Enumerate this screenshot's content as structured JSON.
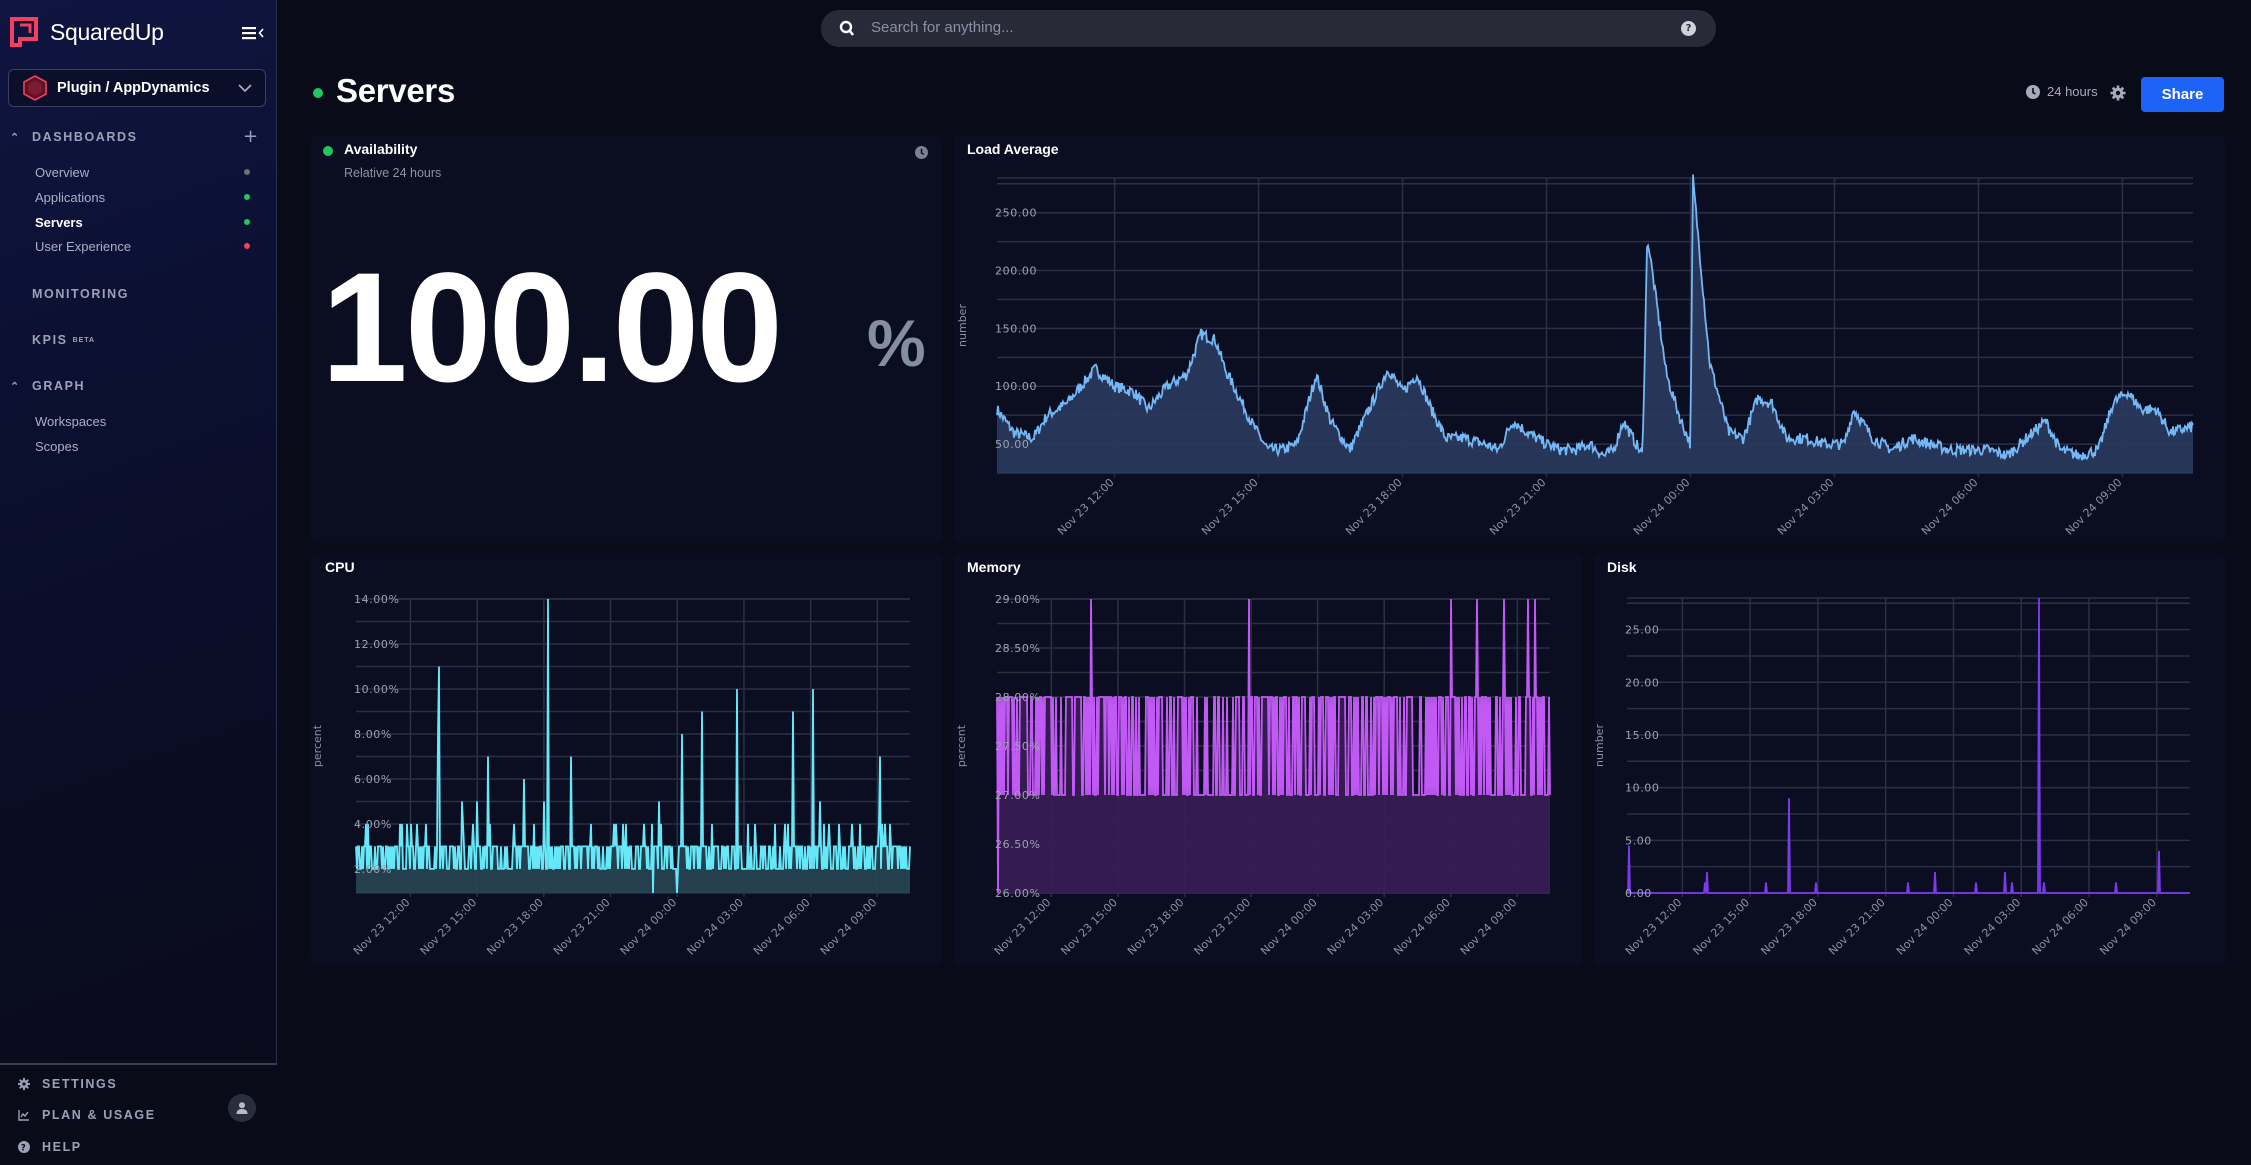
{
  "app": {
    "brand": "SquaredUp",
    "workspace": "Plugin / AppDynamics"
  },
  "sidebar": {
    "sections": [
      {
        "label": "DASHBOARDS",
        "collapsible": true
      },
      {
        "label": "MONITORING",
        "collapsible": false
      },
      {
        "label": "KPIS",
        "badge": "BETA",
        "collapsible": false
      },
      {
        "label": "GRAPH",
        "collapsible": true
      }
    ],
    "dashboards": [
      {
        "label": "Overview",
        "status": "unknown",
        "color": "#6b6f7e"
      },
      {
        "label": "Applications",
        "status": "success",
        "color": "#22c55e"
      },
      {
        "label": "Servers",
        "status": "success",
        "color": "#22c55e",
        "active": true
      },
      {
        "label": "User Experience",
        "status": "error",
        "color": "#f43f5e"
      }
    ],
    "graph_items": [
      {
        "label": "Workspaces"
      },
      {
        "label": "Scopes"
      }
    ],
    "footer": [
      {
        "label": "SETTINGS",
        "icon": "gear-icon"
      },
      {
        "label": "PLAN & USAGE",
        "icon": "chart-line-icon"
      },
      {
        "label": "HELP",
        "icon": "help-circle-icon"
      }
    ]
  },
  "search": {
    "placeholder": "Search for anything..."
  },
  "header": {
    "title": "Servers",
    "status_color": "#22c55e",
    "timeframe": "24 hours",
    "share_label": "Share",
    "share_color": "#1d63f5"
  },
  "tiles": {
    "availability": {
      "title": "Availability",
      "subtitle": "Relative 24 hours",
      "value": "100.00",
      "unit": "%",
      "status_color": "#22c55e"
    }
  },
  "chart_data": [
    {
      "id": "load",
      "title": "Load Average",
      "type": "area",
      "ylabel": "number",
      "color": "#74b7f5",
      "fill": "#2a3a5e",
      "ylim": [
        25,
        280
      ],
      "ygrid_step": 25,
      "yticks": [
        50,
        100,
        150,
        200,
        250
      ],
      "ytick_labels": [
        "50.00",
        "100.00",
        "150.00",
        "200.00",
        "250.00"
      ],
      "xrange_hours": [
        9.55,
        34.47
      ],
      "xticks_hours": [
        12,
        15,
        18,
        21,
        24,
        27,
        30,
        33
      ],
      "xtick_labels": [
        "Nov 23 12:00",
        "Nov 23 15:00",
        "Nov 23 18:00",
        "Nov 23 21:00",
        "Nov 24 00:00",
        "Nov 24 03:00",
        "Nov 24 06:00",
        "Nov 24 09:00"
      ],
      "keypoints": [
        [
          9.55,
          80
        ],
        [
          9.9,
          60
        ],
        [
          10.3,
          55
        ],
        [
          10.6,
          75
        ],
        [
          11.0,
          85
        ],
        [
          11.3,
          100
        ],
        [
          11.6,
          115
        ],
        [
          12.0,
          100
        ],
        [
          12.4,
          95
        ],
        [
          12.7,
          80
        ],
        [
          13.1,
          100
        ],
        [
          13.5,
          110
        ],
        [
          13.8,
          145
        ],
        [
          14.1,
          140
        ],
        [
          14.3,
          115
        ],
        [
          14.6,
          90
        ],
        [
          14.9,
          65
        ],
        [
          15.2,
          45
        ],
        [
          15.5,
          45
        ],
        [
          15.8,
          50
        ],
        [
          16.0,
          80
        ],
        [
          16.2,
          110
        ],
        [
          16.5,
          70
        ],
        [
          16.9,
          45
        ],
        [
          17.3,
          80
        ],
        [
          17.7,
          115
        ],
        [
          18.0,
          95
        ],
        [
          18.3,
          110
        ],
        [
          18.6,
          80
        ],
        [
          18.9,
          55
        ],
        [
          19.3,
          55
        ],
        [
          19.7,
          50
        ],
        [
          20.0,
          45
        ],
        [
          20.3,
          70
        ],
        [
          20.6,
          60
        ],
        [
          21.0,
          50
        ],
        [
          21.3,
          45
        ],
        [
          21.6,
          45
        ],
        [
          21.9,
          50
        ],
        [
          22.2,
          40
        ],
        [
          22.4,
          45
        ],
        [
          22.6,
          70
        ],
        [
          22.8,
          55
        ],
        [
          23.0,
          40
        ],
        [
          23.1,
          230
        ],
        [
          23.5,
          110
        ],
        [
          23.8,
          70
        ],
        [
          24.0,
          50
        ],
        [
          24.05,
          280
        ],
        [
          24.4,
          120
        ],
        [
          24.8,
          60
        ],
        [
          25.1,
          55
        ],
        [
          25.4,
          90
        ],
        [
          25.7,
          85
        ],
        [
          26.0,
          55
        ],
        [
          26.4,
          55
        ],
        [
          26.8,
          50
        ],
        [
          27.2,
          50
        ],
        [
          27.4,
          80
        ],
        [
          27.8,
          55
        ],
        [
          28.2,
          45
        ],
        [
          28.6,
          55
        ],
        [
          29.0,
          50
        ],
        [
          29.4,
          45
        ],
        [
          29.8,
          45
        ],
        [
          30.2,
          45
        ],
        [
          30.6,
          40
        ],
        [
          31.0,
          55
        ],
        [
          31.4,
          70
        ],
        [
          31.7,
          45
        ],
        [
          32.1,
          40
        ],
        [
          32.5,
          45
        ],
        [
          32.8,
          85
        ],
        [
          33.1,
          95
        ],
        [
          33.4,
          80
        ],
        [
          33.7,
          80
        ],
        [
          34.0,
          60
        ],
        [
          34.47,
          65
        ]
      ],
      "noise": 5
    },
    {
      "id": "cpu",
      "title": "CPU",
      "type": "area",
      "ylabel": "percent",
      "color": "#67e8f9",
      "fill": "#274654",
      "ylim": [
        0.93,
        14
      ],
      "ygrid_step": 1,
      "yticks": [
        2,
        4,
        6,
        8,
        10,
        12,
        14
      ],
      "ytick_labels": [
        "2.00%",
        "4.00%",
        "6.00%",
        "8.00%",
        "10.00%",
        "12.00%",
        "14.00%"
      ],
      "xrange_hours": [
        9.55,
        34.47
      ],
      "xticks_hours": [
        12,
        15,
        18,
        21,
        24,
        27,
        30,
        33
      ],
      "xtick_labels": [
        "Nov 23 12:00",
        "Nov 23 15:00",
        "Nov 23 18:00",
        "Nov 23 21:00",
        "Nov 24 00:00",
        "Nov 24 03:00",
        "Nov 24 06:00",
        "Nov 24 09:00"
      ],
      "baseline": [
        2,
        3
      ],
      "small_spike_value": 4,
      "spikes": [
        [
          13.3,
          11
        ],
        [
          13.25,
          8
        ],
        [
          15.5,
          7
        ],
        [
          17.1,
          6
        ],
        [
          18.2,
          14
        ],
        [
          19.2,
          7
        ],
        [
          14.3,
          5
        ],
        [
          15.0,
          5
        ],
        [
          18.0,
          5
        ],
        [
          23.2,
          5
        ],
        [
          24.2,
          8
        ],
        [
          25.1,
          9
        ],
        [
          26.7,
          10
        ],
        [
          29.2,
          9
        ],
        [
          30.1,
          10
        ],
        [
          30.4,
          5
        ],
        [
          33.1,
          7
        ],
        [
          22.5,
          4
        ],
        [
          20.1,
          4
        ]
      ],
      "dips": [
        [
          22.9,
          0.93
        ],
        [
          24.0,
          0.93
        ]
      ]
    },
    {
      "id": "memory",
      "title": "Memory",
      "type": "area",
      "ylabel": "percent",
      "color": "#c15af5",
      "fill": "#391d55",
      "ylim": [
        26,
        29
      ],
      "ygrid_step": 0.25,
      "yticks": [
        26,
        26.5,
        27,
        27.5,
        28,
        28.5,
        29
      ],
      "ytick_labels": [
        "26.00%",
        "26.50%",
        "27.00%",
        "27.50%",
        "28.00%",
        "28.50%",
        "29.00%"
      ],
      "xrange_hours": [
        9.55,
        34.47
      ],
      "xticks_hours": [
        12,
        15,
        18,
        21,
        24,
        27,
        30,
        33
      ],
      "xtick_labels": [
        "Nov 23 12:00",
        "Nov 23 15:00",
        "Nov 23 18:00",
        "Nov 23 21:00",
        "Nov 24 00:00",
        "Nov 24 03:00",
        "Nov 24 06:00",
        "Nov 24 09:00"
      ],
      "levels": [
        27,
        28
      ],
      "spikes": [
        [
          13.8,
          29
        ],
        [
          20.9,
          29
        ],
        [
          30.0,
          29
        ],
        [
          31.2,
          29
        ],
        [
          32.4,
          29
        ],
        [
          33.5,
          29
        ],
        [
          33.8,
          29
        ]
      ],
      "dips": [
        [
          9.6,
          26
        ]
      ]
    },
    {
      "id": "disk",
      "title": "Disk",
      "type": "area",
      "ylabel": "number",
      "color": "#7c3aed",
      "fill": "#241549",
      "ylim": [
        0,
        28
      ],
      "ygrid_step": 2.5,
      "yticks": [
        0,
        5,
        10,
        15,
        20,
        25
      ],
      "ytick_labels": [
        "0.00",
        "5.00",
        "10.00",
        "15.00",
        "20.00",
        "25.00"
      ],
      "xrange_hours": [
        9.55,
        34.47
      ],
      "xticks_hours": [
        12,
        15,
        18,
        21,
        24,
        27,
        30,
        33
      ],
      "xtick_labels": [
        "Nov 23 12:00",
        "Nov 23 15:00",
        "Nov 23 18:00",
        "Nov 23 21:00",
        "Nov 24 00:00",
        "Nov 24 03:00",
        "Nov 24 06:00",
        "Nov 24 09:00"
      ],
      "spikes": [
        [
          9.65,
          4.5
        ],
        [
          13.0,
          1
        ],
        [
          13.1,
          2
        ],
        [
          15.7,
          1
        ],
        [
          16.7,
          9
        ],
        [
          17.9,
          1
        ],
        [
          22.0,
          1
        ],
        [
          23.2,
          2
        ],
        [
          25.0,
          1
        ],
        [
          26.3,
          2
        ],
        [
          26.6,
          1
        ],
        [
          27.8,
          28
        ],
        [
          28.0,
          1
        ],
        [
          31.2,
          1
        ],
        [
          33.1,
          4
        ]
      ]
    }
  ]
}
